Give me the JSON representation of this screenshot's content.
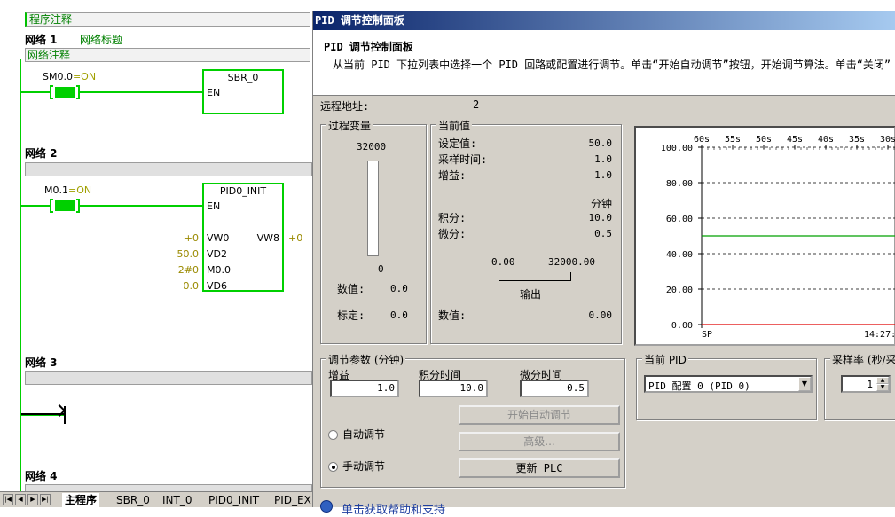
{
  "ladder": {
    "program_comment": "程序注释",
    "networks": [
      {
        "label": "网络 1",
        "title": "网络标题",
        "comment": "网络注释"
      },
      {
        "label": "网络 2"
      },
      {
        "label": "网络 3"
      },
      {
        "label": "网络 4"
      }
    ],
    "contact1": {
      "name": "SM0.0",
      "state": "=ON"
    },
    "contact2": {
      "name": "M0.1",
      "state": "=ON"
    },
    "sbr_box": {
      "title": "SBR_0",
      "en": "EN"
    },
    "pid_box": {
      "title": "PID0_INIT",
      "en": "EN",
      "inputs": [
        {
          "value": "+0",
          "pin": "VW0"
        },
        {
          "value": "50.0",
          "pin": "VD2"
        },
        {
          "value": "2#0",
          "pin": "M0.0"
        },
        {
          "value": "0.0",
          "pin": "VD6"
        }
      ],
      "output_pin": "VW8",
      "output_value": "+0"
    },
    "tabs": [
      "主程序",
      "SBR_0",
      "INT_0",
      "PID0_INIT",
      "PID_EX"
    ]
  },
  "dialog": {
    "title": "PID 调节控制面板",
    "header_title": "PID 调节控制面板",
    "header_desc": "从当前 PID 下拉列表中选择一个 PID 回路或配置进行调节。单击“开始自动调节”按钮，开始调节算法。单击“关闭”",
    "remote_address_label": "远程地址:",
    "remote_address_value": "2",
    "process_variable": {
      "label": "过程变量",
      "max": "32000",
      "min": "0",
      "value_label": "数值:",
      "value": "0.0",
      "scaled_label": "标定:",
      "scaled": "0.0",
      "fill_fraction": 0
    },
    "current_values": {
      "label": "当前值",
      "setpoint_label": "设定值:",
      "setpoint": "50.0",
      "sample_label": "采样时间:",
      "sample": "1.0",
      "gain_label": "增益:",
      "gain": "1.0",
      "unit": "分钟",
      "integral_label": "积分:",
      "integral": "10.0",
      "derivative_label": "微分:",
      "derivative": "0.5",
      "output_min": "0.00",
      "output_max": "32000.00",
      "output_label": "输出",
      "value_label": "数值:",
      "value": "0.00"
    },
    "tuning": {
      "label": "调节参数 (分钟)",
      "gain_label": "增益",
      "gain": "1.0",
      "integral_label": "积分时间",
      "integral": "10.0",
      "derivative_label": "微分时间",
      "derivative": "0.5",
      "auto_label": "自动调节",
      "manual_label": "手动调节",
      "mode": "manual",
      "start_auto_button": "开始自动调节",
      "advanced_button": "高级...",
      "update_plc_button": "更新 PLC"
    },
    "current_pid": {
      "label": "当前 PID",
      "selected": "PID 配置 0 (PID 0)"
    },
    "sample_rate": {
      "label": "采样率 (秒/采",
      "value": "1"
    },
    "help_link": "单击获取帮助和支持"
  },
  "chart_data": {
    "type": "line",
    "x_ticks": [
      "60s",
      "55s",
      "50s",
      "45s",
      "40s",
      "35s",
      "30s"
    ],
    "y_ticks": [
      "100.00",
      "80.00",
      "60.00",
      "40.00",
      "20.00",
      "0.00"
    ],
    "ylim": [
      0,
      100
    ],
    "grid": true,
    "legend_label": "SP",
    "time_label": "14:27:",
    "series": [
      {
        "name": "SP",
        "color": "#00a000",
        "values": [
          50,
          50
        ]
      },
      {
        "color": "#e00000",
        "values": [
          0,
          0
        ]
      }
    ]
  }
}
